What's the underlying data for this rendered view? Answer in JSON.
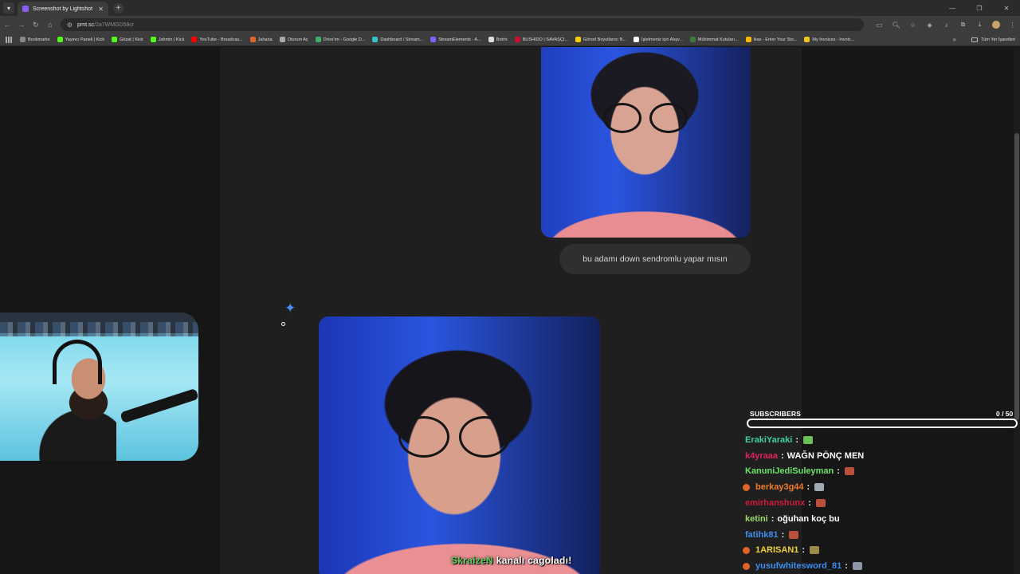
{
  "browser": {
    "tab_title": "Screenshot by Lightshot",
    "url_host": "prnt.sc",
    "url_path": "/2a7WMGD58cr",
    "bookmarks": [
      {
        "label": "Bookmarks",
        "color": "#888888"
      },
      {
        "label": "Yayıncı Paneli | Kick",
        "color": "#53fc18"
      },
      {
        "label": "Gözat | Kick",
        "color": "#53fc18"
      },
      {
        "label": "Jahmin | Kick",
        "color": "#53fc18"
      },
      {
        "label": "YouTube - Broadcas...",
        "color": "#ff0000"
      },
      {
        "label": "Jaharia",
        "color": "#e0632a"
      },
      {
        "label": "Oturum Aç",
        "color": "#aaaaaa"
      },
      {
        "label": "Drive'ım - Google D...",
        "color": "#3fb06b"
      },
      {
        "label": "Dashboard / Stream...",
        "color": "#36c0c8"
      },
      {
        "label": "StreamElements - A...",
        "color": "#7b61ff"
      },
      {
        "label": "Botrix",
        "color": "#dddddd"
      },
      {
        "label": "BUSHIDO | SAVAŞÇI...",
        "color": "#c8102e"
      },
      {
        "label": "Görsel Boyutlarını N...",
        "color": "#ffcc00"
      },
      {
        "label": "İşletmeniz için Alışv...",
        "color": "#ffffff"
      },
      {
        "label": "Mühimmat Kutuları...",
        "color": "#3d7a3d"
      },
      {
        "label": "ikas - Enter Your Sto...",
        "color": "#ffb800"
      },
      {
        "label": "My Invoices - Invoic...",
        "color": "#f0c419"
      }
    ],
    "bookmarks_all": "Tüm Yer İşaretleri"
  },
  "content": {
    "bubble_text": "bu adamı down sendromlu yapar mısın"
  },
  "overlay": {
    "subscribers_label": "SUBSCRIBERS",
    "subscribers_count": "0 / 50",
    "subscribers_progress": 0.0,
    "accent": "#8b5cf6"
  },
  "chat": [
    {
      "user": "ErakiYaraki",
      "color": "#3fd1a0",
      "badge": false,
      "message": "",
      "emote_color": "#6abf5a"
    },
    {
      "user": "k4yraaa",
      "color": "#e0245e",
      "badge": false,
      "message": "WAĞN PÖNÇ MEN",
      "emote_color": ""
    },
    {
      "user": "KanuniJediSuleyman",
      "color": "#6be36b",
      "badge": false,
      "message": "",
      "emote_color": "#b8503c"
    },
    {
      "user": "berkay3g44",
      "color": "#f07b2a",
      "badge": true,
      "message": "",
      "emote_color": "#9fa9b5"
    },
    {
      "user": "emirhanshunx",
      "color": "#d01a3a",
      "badge": false,
      "message": "",
      "emote_color": "#b8503c"
    },
    {
      "user": "ketini",
      "color": "#9fd86a",
      "badge": false,
      "message": "oğuhan koç bu",
      "emote_color": ""
    },
    {
      "user": "fatihk81",
      "color": "#3d8ef0",
      "badge": false,
      "message": "",
      "emote_color": "#b8503c"
    },
    {
      "user": "1ARISAN1",
      "color": "#f0d23a",
      "badge": true,
      "message": "",
      "emote_color": "#9a8a4a"
    },
    {
      "user": "yusufwhitesword_81",
      "color": "#3d8ef0",
      "badge": true,
      "message": "",
      "emote_color": "#8a96a8"
    }
  ],
  "caption": {
    "user": "SkraizeN",
    "text": "kanalı cagoladı!"
  }
}
